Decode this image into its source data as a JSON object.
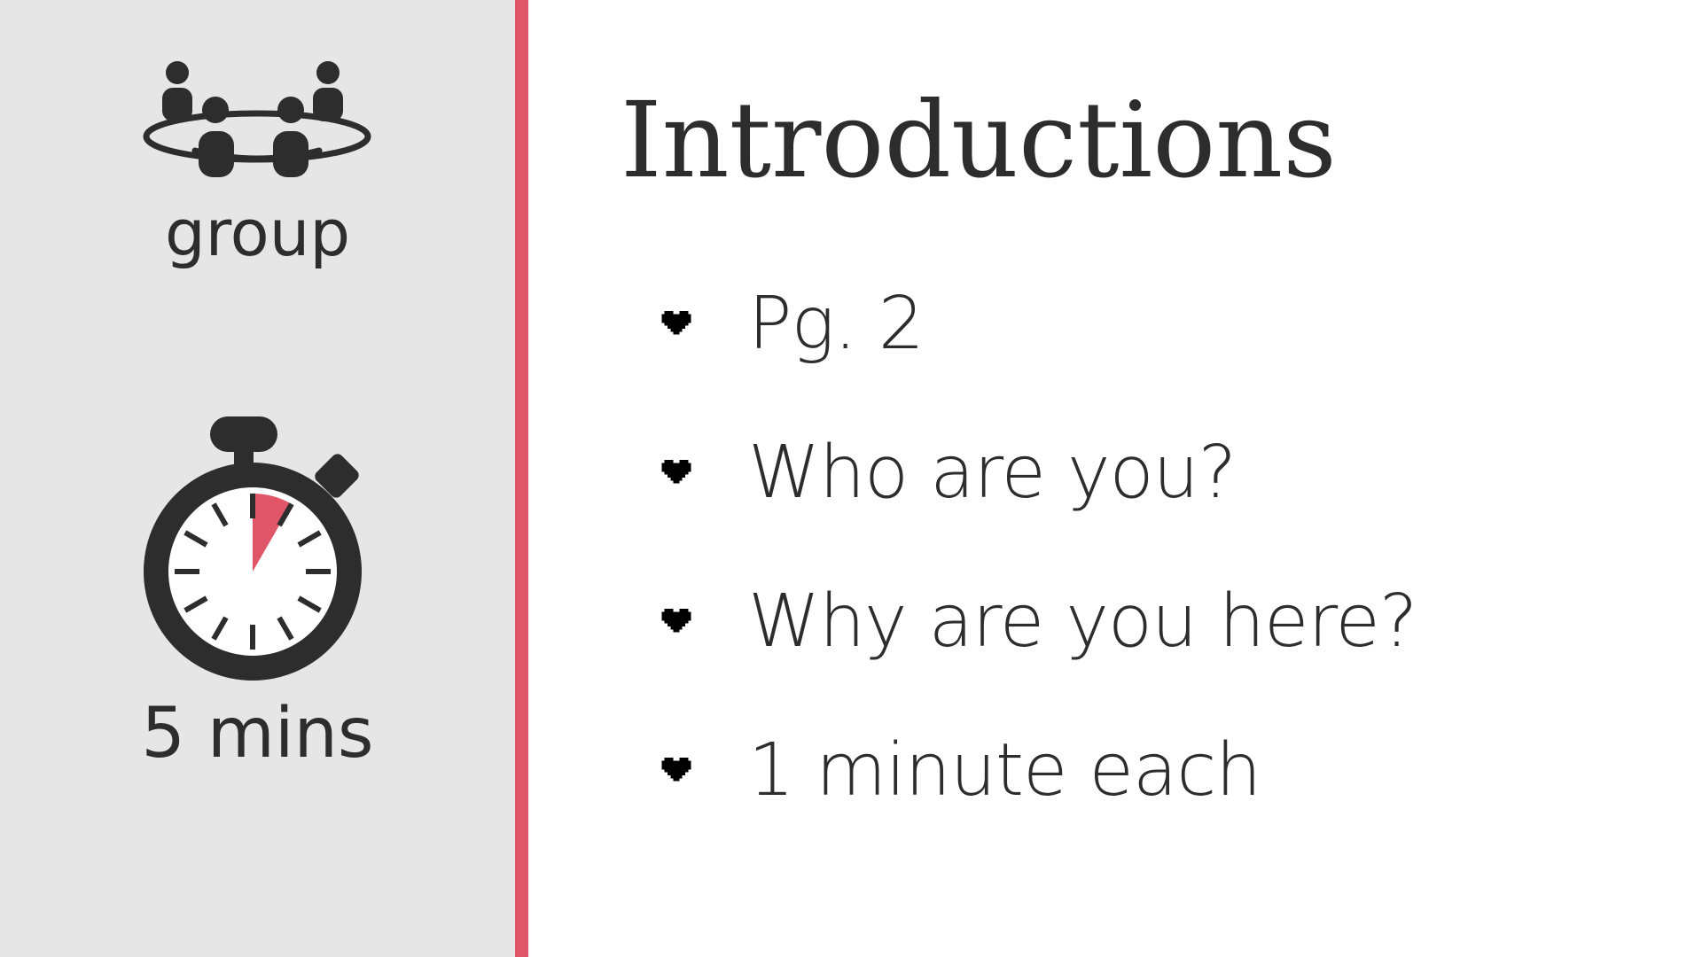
{
  "colors": {
    "sidebar_bg": "#e6e6e6",
    "accent": "#e05567",
    "icon_dark": "#2d2d2d",
    "text": "#2d2d2d"
  },
  "sidebar": {
    "activity": {
      "icon": "group-icon",
      "label": "group"
    },
    "duration": {
      "icon": "stopwatch-icon",
      "label": "5 mins",
      "elapsed_fraction": 0.0833
    }
  },
  "main": {
    "title": "Introductions",
    "bullet_icon": "heart-icon",
    "bullets": [
      "Pg. 2",
      "Who are you?",
      "Why are you here?",
      "1 minute each"
    ]
  }
}
